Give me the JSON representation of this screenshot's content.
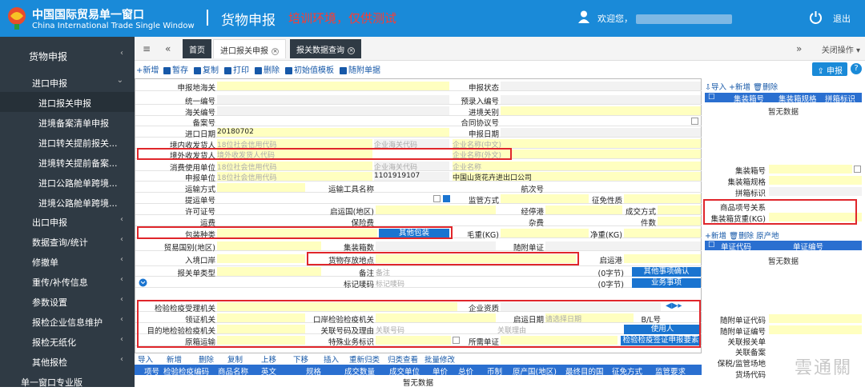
{
  "header": {
    "cn_title": "中国国际贸易单一窗口",
    "en_title": "China International Trade Single Window",
    "module": "货物申报",
    "env_note": "培训环境，仅供测试",
    "welcome": "欢迎您，",
    "logout": "退出"
  },
  "sidebar": {
    "items": [
      {
        "label": "货物申报",
        "chev": "‹"
      },
      {
        "label": "进口申报",
        "chev": "⌄"
      },
      {
        "label": "进口报关申报"
      },
      {
        "label": "进境备案清单申报"
      },
      {
        "label": "进口转关提前报关..."
      },
      {
        "label": "进境转关提前备案..."
      },
      {
        "label": "进口公路舱单跨境..."
      },
      {
        "label": "进境公路舱单跨境..."
      },
      {
        "label": "出口申报",
        "chev": "‹"
      },
      {
        "label": "数据查询/统计",
        "chev": "‹"
      },
      {
        "label": "修撤单",
        "chev": "‹"
      },
      {
        "label": "重传/补传信息",
        "chev": "‹"
      },
      {
        "label": "参数设置",
        "chev": "‹"
      },
      {
        "label": "报检企业信息维护",
        "chev": "‹"
      },
      {
        "label": "报检无纸化",
        "chev": "‹"
      },
      {
        "label": "其他报检",
        "chev": "‹"
      },
      {
        "label": "单一窗口专业版"
      }
    ]
  },
  "tabs": {
    "home": "首页",
    "t1": "进口报关申报",
    "t2": "报关数据查询",
    "close_ops": "关闭操作"
  },
  "toolbar": {
    "add": "新增",
    "save": "暂存",
    "copy": "复制",
    "print": "打印",
    "del": "删除",
    "init": "初始值模板",
    "attach": "随附单据",
    "declare": "申报",
    "help": "?"
  },
  "form": {
    "l_port": "申报地海关",
    "l_status": "申报状态",
    "l_uniform": "统一编号",
    "l_preentry": "预录入编号",
    "l_cusno": "海关编号",
    "l_entryport": "进境关别",
    "l_record": "备案号",
    "l_contract": "合同协议号",
    "l_impdate": "进口日期",
    "v_impdate": "20180702",
    "l_decldate": "申报日期",
    "l_consignee": "境内收发货人",
    "ph_credit": "18位社会信用代码",
    "ph_cuscode": "企业海关代码",
    "ph_name_cn": "企业名称(中文)",
    "l_consignor": "境外收发货人",
    "ph_consignor": "境外收发货人代码",
    "ph_name_en": "企业名称(外文)",
    "l_consumer": "消费使用单位",
    "ph_name": "企业名称",
    "l_declarer": "申报单位",
    "v_cuscode": "1101919107",
    "v_company": "中国山货花卉进出口公司",
    "l_transmode": "运输方式",
    "l_transtool": "运输工具名称",
    "l_voyage": "航次号",
    "l_bl": "提运单号",
    "l_supervise": "监管方式",
    "l_exempt": "征免性质",
    "l_license": "许可证号",
    "l_depcountry": "启运国(地区)",
    "l_via": "经停港",
    "l_deal": "成交方式",
    "l_freight": "运费",
    "l_insurance": "保险费",
    "l_misc": "杂费",
    "l_pieces": "件数",
    "l_packing": "包装种类",
    "b_otherpack": "其他包装",
    "l_gross": "毛重(KG)",
    "l_net": "净重(KG)",
    "l_tradecountry": "贸易国别(地区)",
    "l_container_cnt": "集装箱数",
    "l_attachdoc": "随附单证",
    "l_entryport2": "入境口岸",
    "l_storage": "货物存放地点",
    "l_departport": "启运港",
    "l_formtype": "报关单类型",
    "l_remark": "备注",
    "ph_remark": "备注",
    "bytes1": "(0字节)",
    "b_special": "其他事项确认",
    "l_mark": "标记唛码",
    "ph_mark": "标记唛码",
    "bytes2": "(0字节)",
    "b_business": "业务事项",
    "l_inspect": "检验检疫受理机关",
    "l_entqual": "企业资质",
    "l_recv": "领证机关",
    "l_portinsp": "口岸检验检疫机关",
    "l_startdate": "启运日期",
    "ph_date": "请选择日期",
    "l_bl2": "B/L号",
    "l_destinsp": "目的地检验检疫机关",
    "l_relno": "关联号码及理由",
    "ph_relno": "关联号码",
    "ph_reason": "关联理由",
    "b_user": "使用人",
    "l_origtrans": "原箱运输",
    "l_special": "特殊业务标识",
    "l_reqdoc": "所需单证",
    "b_cert": "检验检疫签证申报要素"
  },
  "right": {
    "add_import": "导入",
    "add": "新增",
    "del": "删除",
    "h1": "集装箱号",
    "h2": "集装箱规格",
    "h3": "拼箱标识",
    "nodata": "暂无数据",
    "r1": "集装箱号",
    "r2": "集装箱规格",
    "r3": "拼箱标识",
    "r4": "商品项号关系",
    "r5": "集装箱货重(KG)",
    "add2": "新增",
    "del2": "删除",
    "orig": "原产地",
    "hh1": "单证代码",
    "hh2": "单证编号",
    "nodata2": "暂无数据",
    "f1": "随附单证代码",
    "f2": "随附单证编号",
    "f3": "关联报关单",
    "f4": "关联备案",
    "f5": "保税/监管场地",
    "f6": "货场代码"
  },
  "grid": {
    "bar": [
      "导入",
      "新增",
      "删除",
      "复制",
      "上移",
      "下移",
      "插入",
      "重新归类",
      "归类查看",
      "批量修改"
    ],
    "cols": [
      "项号",
      "检验检疫编码",
      "商品名称",
      "英文",
      "规格",
      "成交数量",
      "成交单位",
      "单价",
      "总价",
      "币制",
      "原产国(地区)",
      "最终目的国",
      "征免方式",
      "监管要求"
    ],
    "nodata": "暂无数据"
  },
  "watermark": "雲通關"
}
